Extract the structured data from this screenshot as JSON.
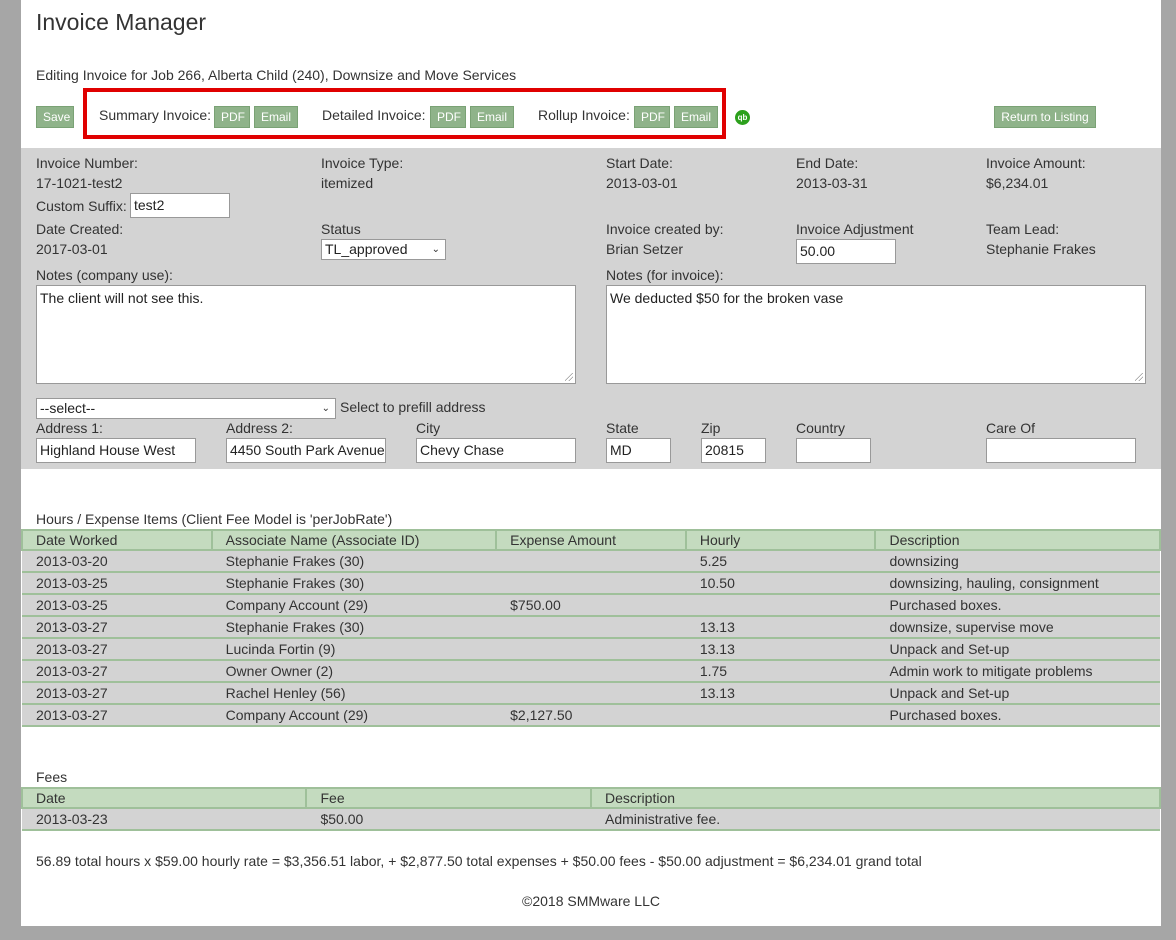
{
  "header": {
    "title": "Invoice Manager",
    "subtitle": "Editing Invoice for Job 266, Alberta Child (240), Downsize and Move Services"
  },
  "toolbar": {
    "save_label": "Save",
    "summary_label": "Summary Invoice:",
    "detailed_label": "Detailed Invoice:",
    "rollup_label": "Rollup Invoice:",
    "pdf_label": "PDF",
    "email_label": "Email",
    "qb_icon": "qb",
    "return_label": "Return to Listing"
  },
  "invoice": {
    "number_label": "Invoice Number:",
    "number": "17-1021-test2",
    "type_label": "Invoice Type:",
    "type": "itemized",
    "start_label": "Start Date:",
    "start": "2013-03-01",
    "end_label": "End Date:",
    "end": "2013-03-31",
    "amount_label": "Invoice Amount:",
    "amount": "$6,234.01",
    "suffix_label": "Custom Suffix:",
    "suffix": "test2",
    "created_label": "Date Created:",
    "created": "2017-03-01",
    "status_label": "Status",
    "status": "TL_approved",
    "created_by_label": "Invoice created by:",
    "created_by": "Brian Setzer",
    "adjustment_label": "Invoice Adjustment",
    "adjustment": "50.00",
    "team_lead_label": "Team Lead:",
    "team_lead": "Stephanie Frakes",
    "notes_company_label": "Notes (company use):",
    "notes_company": "The client will not see this.",
    "notes_invoice_label": "Notes (for invoice):",
    "notes_invoice": "We deducted $50 for the broken vase"
  },
  "address": {
    "prefill_select": "--select--",
    "prefill_label": "Select to prefill address",
    "address1_label": "Address 1:",
    "address1": "Highland House West",
    "address2_label": "Address 2:",
    "address2": "4450 South Park Avenue",
    "city_label": "City",
    "city": "Chevy Chase",
    "state_label": "State",
    "state": "MD",
    "zip_label": "Zip",
    "zip": "20815",
    "country_label": "Country",
    "country": "",
    "care_of_label": "Care Of",
    "care_of": ""
  },
  "hours": {
    "title": "Hours / Expense Items (Client Fee Model is 'perJobRate')",
    "columns": [
      "Date Worked",
      "Associate Name (Associate ID)",
      "Expense Amount",
      "Hourly",
      "Description"
    ],
    "rows": [
      [
        "2013-03-20",
        "Stephanie Frakes (30)",
        "",
        "5.25",
        "downsizing"
      ],
      [
        "2013-03-25",
        "Stephanie Frakes (30)",
        "",
        "10.50",
        "downsizing, hauling, consignment"
      ],
      [
        "2013-03-25",
        "Company Account (29)",
        "$750.00",
        "",
        "Purchased boxes."
      ],
      [
        "2013-03-27",
        "Stephanie Frakes (30)",
        "",
        "13.13",
        "downsize, supervise move"
      ],
      [
        "2013-03-27",
        "Lucinda Fortin (9)",
        "",
        "13.13",
        "Unpack and Set-up"
      ],
      [
        "2013-03-27",
        "Owner Owner (2)",
        "",
        "1.75",
        "Admin work to mitigate problems"
      ],
      [
        "2013-03-27",
        "Rachel Henley (56)",
        "",
        "13.13",
        "Unpack and Set-up"
      ],
      [
        "2013-03-27",
        "Company Account (29)",
        "$2,127.50",
        "",
        "Purchased boxes."
      ]
    ]
  },
  "fees": {
    "title": "Fees",
    "columns": [
      "Date",
      "Fee",
      "Description"
    ],
    "rows": [
      [
        "2013-03-23",
        "$50.00",
        "Administrative fee."
      ]
    ]
  },
  "summary": "56.89 total hours x $59.00 hourly rate = $3,356.51 labor, + $2,877.50 total expenses + $50.00 fees - $50.00 adjustment = $6,234.01 grand total",
  "footer": "©2018 SMMware LLC",
  "colors": {
    "button": "#8fb38a",
    "table_header": "#c4dbbf",
    "panel": "#d3d3d3",
    "highlight": "#e00000"
  }
}
